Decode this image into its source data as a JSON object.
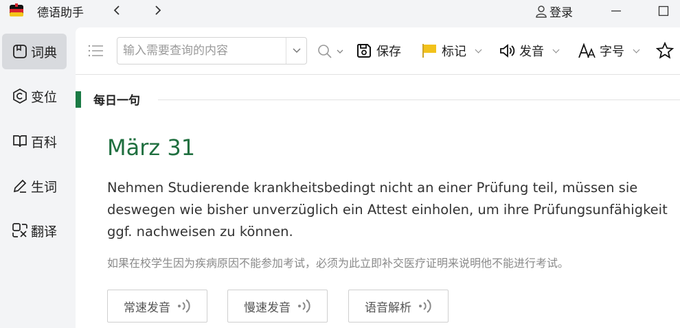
{
  "app": {
    "title": "德语助手"
  },
  "titlebar": {
    "login_label": "登录"
  },
  "sidebar": {
    "items": [
      {
        "label": "词典",
        "icon": "dictionary-icon",
        "active": true
      },
      {
        "label": "变位",
        "icon": "conjugation-icon"
      },
      {
        "label": "百科",
        "icon": "encyclopedia-icon"
      },
      {
        "label": "生词",
        "icon": "vocabulary-icon"
      },
      {
        "label": "翻译",
        "icon": "translate-icon"
      }
    ]
  },
  "toolbar": {
    "search_placeholder": "输入需要查询的内容",
    "save_label": "保存",
    "mark_label": "标记",
    "sound_label": "发音",
    "font_label": "字号",
    "mark_flag_color": "#f2c21b"
  },
  "daily": {
    "title": "每日一句",
    "date": "März 31",
    "german_text": "Nehmen Studierende krankheitsbedingt nicht an einer Prüfung teil, müssen sie deswegen wie bisher unverzüglich ein Attest einholen, um ihre Prüfungsunfähigkeit ggf. nachweisen zu können.",
    "chinese_text": "如果在校学生因为疾病原因不能参加考试，必须为此立即补交医疗证明来说明他不能进行考试。",
    "buttons": {
      "normal_speed": "常速发音",
      "slow_speed": "慢速发音",
      "analysis": "语音解析"
    },
    "accent_color": "#1a7a44"
  }
}
